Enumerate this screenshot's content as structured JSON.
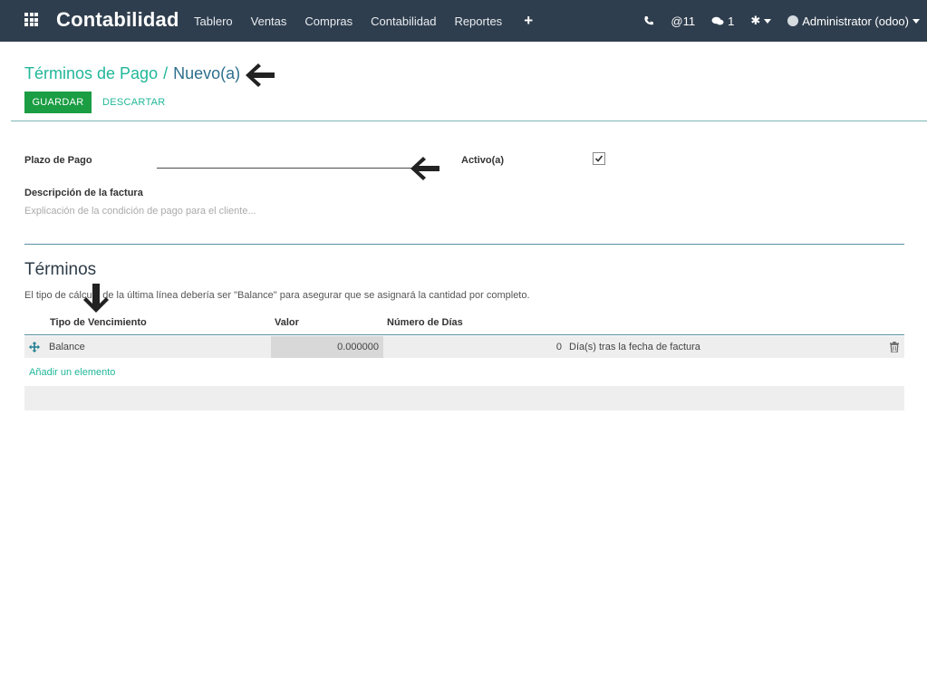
{
  "navbar": {
    "brand": "Contabilidad",
    "menu": [
      "Tablero",
      "Ventas",
      "Compras",
      "Contabilidad",
      "Reportes"
    ],
    "plus": "+",
    "phone": "☎",
    "mentions": "@11",
    "chat_count": "1",
    "debug": "✱",
    "user": "Administrator (odoo)"
  },
  "breadcrumb": {
    "parent": "Términos de Pago",
    "separator": "/",
    "current": "Nuevo(a)"
  },
  "buttons": {
    "save": "GUARDAR",
    "discard": "DESCARTAR"
  },
  "form": {
    "payment_term_label": "Plazo de Pago",
    "payment_term_value": "",
    "active_label": "Activo(a)",
    "active_checked": true,
    "invoice_desc_label": "Descripción de la factura",
    "invoice_desc_placeholder": "Explicación de la condición de pago para el cliente..."
  },
  "terms": {
    "title": "Términos",
    "hint": "El tipo de cálculo de la última línea debería ser \"Balance\" para asegurar que se asignará la cantidad por completo.",
    "columns": [
      "Tipo de Vencimiento",
      "Valor",
      "Número de Días"
    ],
    "rows": [
      {
        "type": "Balance",
        "value": "0.000000",
        "days": "0",
        "days_label": "Día(s) tras la fecha de factura"
      }
    ],
    "add_item": "Añadir un elemento"
  },
  "colors": {
    "navbar": "#2f3e4e",
    "accent": "#21b799",
    "save_button": "#1b9d43"
  }
}
